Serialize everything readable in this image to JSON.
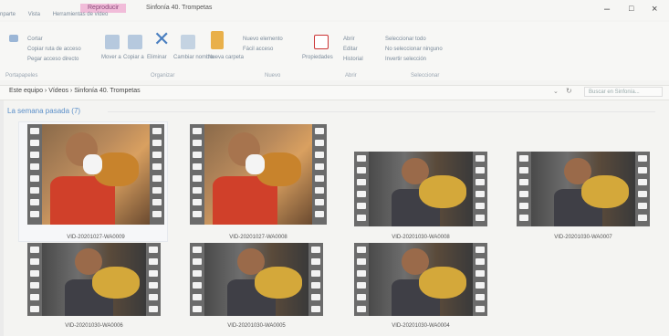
{
  "window": {
    "context_tab": "Reproducir",
    "title": "Sinfonía 40. Trompetas",
    "min": "–",
    "max": "□",
    "close": "×"
  },
  "ribbon_tabs": [
    "nparte",
    "Vista",
    "Herramientas de vídeo"
  ],
  "ribbon": {
    "cortar": "Cortar",
    "copiar_ruta": "Copiar ruta de acceso",
    "pegar_acceso": "Pegar acceso directo",
    "mover_a": "Mover a",
    "copiar_a": "Copiar a",
    "eliminar": "Eliminar",
    "cambiar_nombre": "Cambiar nombre",
    "nueva_carpeta": "Nueva carpeta",
    "nuevo_elemento": "Nuevo elemento",
    "facil_acceso": "Fácil acceso",
    "propiedades": "Propiedades",
    "abrir": "Abrir",
    "editar": "Editar",
    "historial": "Historial",
    "seleccionar_todo": "Seleccionar todo",
    "no_seleccionar": "No seleccionar ninguno",
    "invertir": "Invertir selección",
    "grp_portapapeles": "Portapapeles",
    "grp_organizar": "Organizar",
    "grp_nuevo": "Nuevo",
    "grp_abrir": "Abrir",
    "grp_seleccionar": "Seleccionar"
  },
  "address": {
    "path": "Este equipo  ›  Vídeos  ›  Sinfonía 40. Trompetas",
    "search_placeholder": "Buscar en Sinfonía..."
  },
  "group_header": "La semana pasada (7)",
  "files": [
    {
      "name": "VID-20201027-WA0009",
      "scene": "red"
    },
    {
      "name": "VID-20201027-WA0008",
      "scene": "red"
    },
    {
      "name": "VID-20201030-WA0008",
      "scene": "dark"
    },
    {
      "name": "VID-20201030-WA0007",
      "scene": "dark"
    },
    {
      "name": "VID-20201030-WA0006",
      "scene": "dark"
    },
    {
      "name": "VID-20201030-WA0005",
      "scene": "dark"
    },
    {
      "name": "VID-20201030-WA0004",
      "scene": "dark"
    }
  ],
  "colors": {
    "accent": "#3b86d6",
    "context_tab": "#f1bcd9",
    "group_header": "#5b8fc9"
  }
}
